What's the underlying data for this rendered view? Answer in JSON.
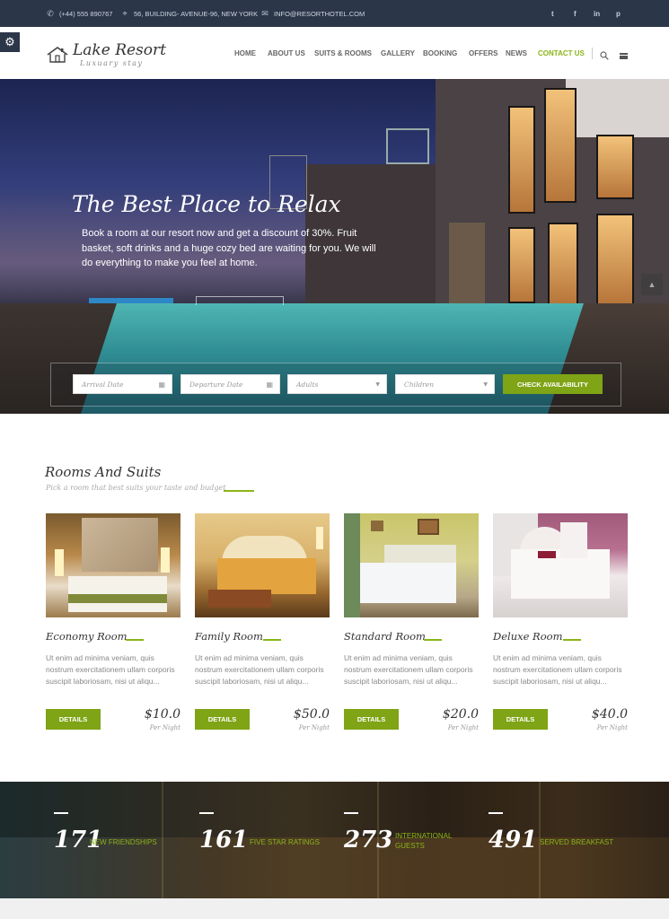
{
  "topbar": {
    "phone": "(+44) 555 890767",
    "address": "56, BUILDING- AVENUE-96, NEW YORK",
    "email": "INFO@RESORTHOTEL.COM",
    "social": [
      "twitter-icon",
      "facebook-icon",
      "linkedin-icon",
      "pinterest-icon"
    ],
    "social_glyphs": [
      "t",
      "f",
      "in",
      "p"
    ]
  },
  "logo": {
    "name": "Lake Resort",
    "tagline": "Luxuary stay"
  },
  "nav": {
    "items": [
      "HOME",
      "ABOUT US",
      "SUITS & ROOMS",
      "GALLERY",
      "BOOKING",
      "OFFERS",
      "NEWS",
      "CONTACT US"
    ],
    "active": "CONTACT US"
  },
  "hero": {
    "title": "The Best Place to Relax",
    "text": "Book a room at our resort now and get a discount of 30%. Fruit basket, soft drinks and a huge cozy bed are waiting for you. We will do everything to make you feel at home."
  },
  "booking": {
    "arrival_placeholder": "Arrival Date",
    "departure_placeholder": "Departure Date",
    "adults_placeholder": "Adults",
    "children_placeholder": "Children",
    "check_label": "CHECK AVAILABILITY"
  },
  "rooms": {
    "title": "Rooms And Suits",
    "subtitle": "Pick a room that best suits your taste and budget",
    "details_label": "DETAILS",
    "per_night": "Per Night",
    "items": [
      {
        "name": "Economy Room",
        "desc": "Ut enim ad minima veniam, quis nostrum exercitationem ullam corporis suscipit laboriosam, nisi ut aliqu...",
        "price": "$10.0"
      },
      {
        "name": "Family Room",
        "desc": "Ut enim ad minima veniam, quis nostrum exercitationem ullam corporis suscipit laboriosam, nisi ut aliqu...",
        "price": "$50.0"
      },
      {
        "name": "Standard Room",
        "desc": "Ut enim ad minima veniam, quis nostrum exercitationem ullam corporis suscipit laboriosam, nisi ut aliqu...",
        "price": "$20.0"
      },
      {
        "name": "Deluxe Room",
        "desc": "Ut enim ad minima veniam, quis nostrum exercitationem ullam corporis suscipit laboriosam, nisi ut aliqu...",
        "price": "$40.0"
      }
    ]
  },
  "counters": [
    {
      "value": "171",
      "label": "NEW FRIENDSHIPS"
    },
    {
      "value": "161",
      "label": "FIVE STAR RATINGS"
    },
    {
      "value": "273",
      "label": "INTERNATIONAL GUESTS"
    },
    {
      "value": "491",
      "label": "SERVED BREAKFAST"
    }
  ],
  "colors": {
    "accent": "#8ab517",
    "button": "#7fa416",
    "topbar": "#2b3649"
  }
}
